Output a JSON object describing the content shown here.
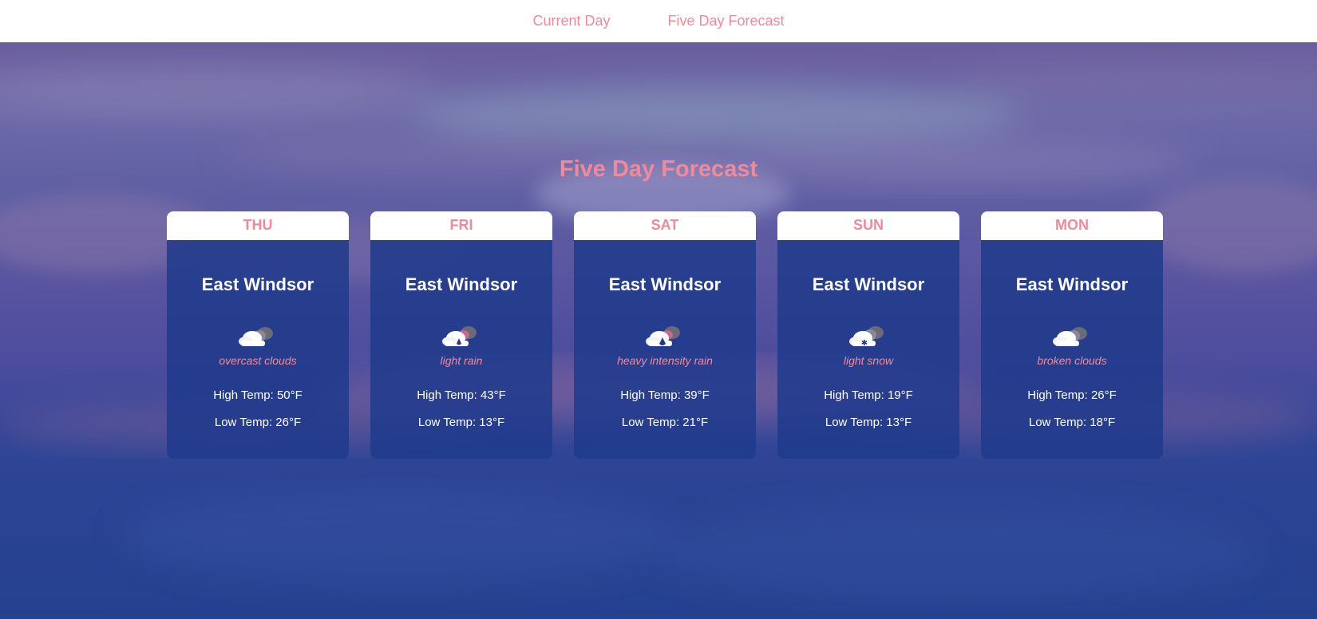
{
  "nav": {
    "links": [
      {
        "label": "Current Day"
      },
      {
        "label": "Five Day Forecast"
      }
    ]
  },
  "page": {
    "title": "Five Day Forecast"
  },
  "forecast": [
    {
      "day": "THU",
      "city": "East Windsor",
      "icon": "overcast-clouds-icon",
      "description": "overcast clouds",
      "high": "High Temp: 50°F",
      "low": "Low Temp: 26°F"
    },
    {
      "day": "FRI",
      "city": "East Windsor",
      "icon": "light-rain-icon",
      "description": "light rain",
      "high": "High Temp: 43°F",
      "low": "Low Temp: 13°F"
    },
    {
      "day": "SAT",
      "city": "East Windsor",
      "icon": "heavy-rain-icon",
      "description": "heavy intensity rain",
      "high": "High Temp: 39°F",
      "low": "Low Temp: 21°F"
    },
    {
      "day": "SUN",
      "city": "East Windsor",
      "icon": "light-snow-icon",
      "description": "light snow",
      "high": "High Temp: 19°F",
      "low": "Low Temp: 13°F"
    },
    {
      "day": "MON",
      "city": "East Windsor",
      "icon": "broken-clouds-icon",
      "description": "broken clouds",
      "high": "High Temp: 26°F",
      "low": "Low Temp: 18°F"
    }
  ],
  "colors": {
    "accent": "#f08a9a",
    "card_bg": "#1f3a8c",
    "sky_top": "#6b5d9e",
    "sky_bottom": "#24418f"
  }
}
